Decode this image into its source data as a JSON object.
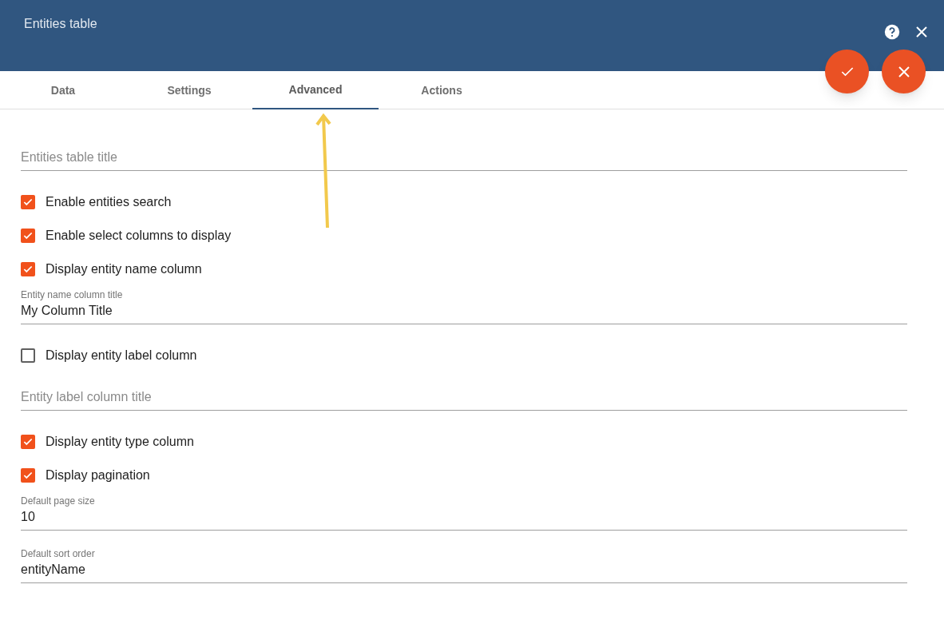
{
  "window": {
    "title": "Entities table"
  },
  "tabs": [
    {
      "label": "Data",
      "selected": false
    },
    {
      "label": "Settings",
      "selected": false
    },
    {
      "label": "Advanced",
      "selected": true
    },
    {
      "label": "Actions",
      "selected": false
    }
  ],
  "items": [
    {
      "kind": "field",
      "placeholder": "Entities table title"
    },
    {
      "kind": "checkbox",
      "label": "Enable entities search",
      "checked": true
    },
    {
      "kind": "checkbox",
      "label": "Enable select columns to display",
      "checked": true
    },
    {
      "kind": "checkbox",
      "label": "Display entity name column",
      "checked": true
    },
    {
      "kind": "field",
      "label": "Entity name column title",
      "value": "My Column Title"
    },
    {
      "kind": "checkbox",
      "label": "Display entity label column",
      "checked": false
    },
    {
      "kind": "field",
      "placeholder": "Entity label column title"
    },
    {
      "kind": "checkbox",
      "label": "Display entity type column",
      "checked": true
    },
    {
      "kind": "checkbox",
      "label": "Display pagination",
      "checked": true
    },
    {
      "kind": "field",
      "label": "Default page size",
      "value": "10"
    },
    {
      "kind": "field",
      "label": "Default sort order",
      "value": "entityName"
    }
  ]
}
